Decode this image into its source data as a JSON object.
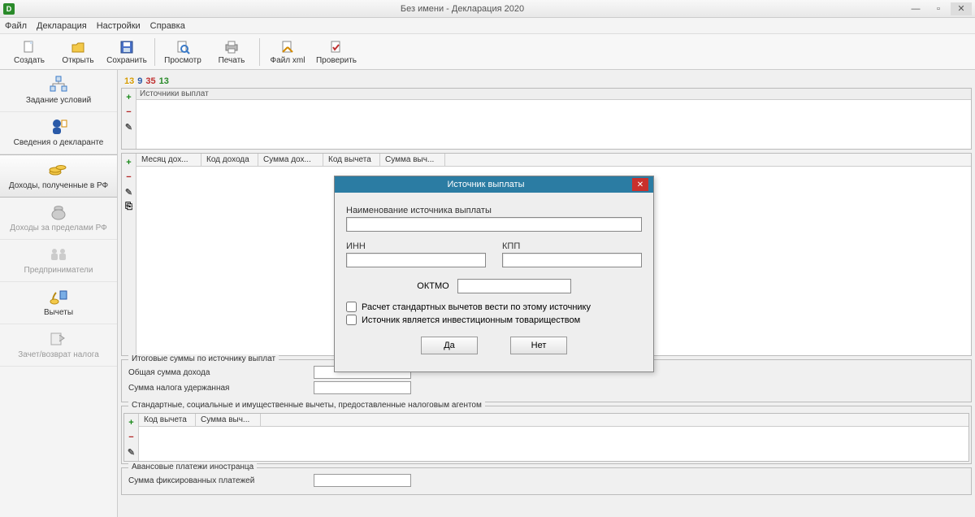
{
  "window": {
    "title": "Без имени - Декларация 2020"
  },
  "menu": {
    "file": "Файл",
    "declaration": "Декларация",
    "settings": "Настройки",
    "help": "Справка"
  },
  "toolbar": {
    "create": "Создать",
    "open": "Открыть",
    "save": "Сохранить",
    "preview": "Просмотр",
    "print": "Печать",
    "filexml": "Файл xml",
    "check": "Проверить"
  },
  "sidebar": {
    "conditions": "Задание условий",
    "declarant": "Сведения о декларанте",
    "income_rf": "Доходы, полученные в РФ",
    "income_abroad": "Доходы за пределами РФ",
    "entrepreneurs": "Предприниматели",
    "deductions": "Вычеты",
    "tax_return": "Зачет/возврат налога"
  },
  "tabs": {
    "n1": "13",
    "n2": "9",
    "n3": "35",
    "n4": "13"
  },
  "sources": {
    "header": "Источники выплат"
  },
  "income_grid": {
    "cols": [
      "Месяц дох...",
      "Код дохода",
      "Сумма дох...",
      "Код вычета",
      "Сумма выч..."
    ]
  },
  "totals": {
    "legend": "Итоговые суммы по источнику выплат",
    "total_income": "Общая сумма дохода",
    "tax_withheld": "Сумма налога удержанная"
  },
  "agent_deductions": {
    "legend": "Стандартные, социальные и имущественные вычеты, предоставленные налоговым агентом",
    "cols": [
      "Код вычета",
      "Сумма выч..."
    ]
  },
  "advance": {
    "legend": "Авансовые платежи иностранца",
    "fixed_sum": "Сумма фиксированных платежей"
  },
  "dialog": {
    "title": "Источник выплаты",
    "name_label": "Наименование источника выплаты",
    "inn": "ИНН",
    "kpp": "КПП",
    "oktmo": "ОКТМО",
    "chk1": "Расчет стандартных вычетов вести по этому источнику",
    "chk2": "Источник является инвестиционным товариществом",
    "yes": "Да",
    "no": "Нет"
  }
}
